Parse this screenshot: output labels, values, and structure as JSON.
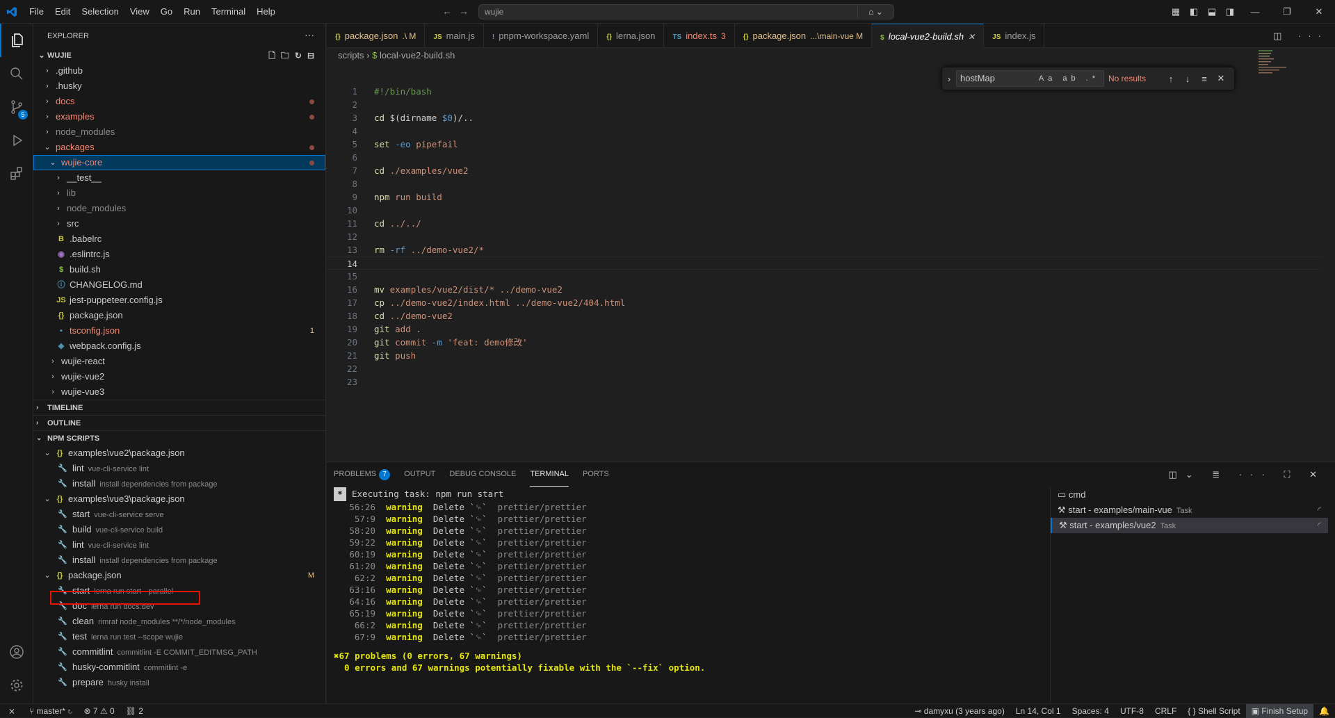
{
  "titlebar": {
    "menu": [
      "File",
      "Edit",
      "Selection",
      "View",
      "Go",
      "Run",
      "Terminal",
      "Help"
    ],
    "search": "wujie"
  },
  "explorer": {
    "title": "EXPLORER",
    "root": "WUJIE",
    "items": [
      {
        "label": ".github",
        "type": "folder",
        "depth": 0,
        "open": false
      },
      {
        "label": ".husky",
        "type": "folder",
        "depth": 0,
        "open": false
      },
      {
        "label": "docs",
        "type": "folder",
        "depth": 0,
        "open": false,
        "modified": true
      },
      {
        "label": "examples",
        "type": "folder",
        "depth": 0,
        "open": false,
        "modified": true
      },
      {
        "label": "node_modules",
        "type": "folder",
        "depth": 0,
        "open": false,
        "dim": true
      },
      {
        "label": "packages",
        "type": "folder",
        "depth": 0,
        "open": true,
        "modified": true
      },
      {
        "label": "wujie-core",
        "type": "folder",
        "depth": 1,
        "open": true,
        "modified": true,
        "selected": true
      },
      {
        "label": "__test__",
        "type": "folder",
        "depth": 2,
        "open": false
      },
      {
        "label": "lib",
        "type": "folder",
        "depth": 2,
        "open": false,
        "dim": true
      },
      {
        "label": "node_modules",
        "type": "folder",
        "depth": 2,
        "open": false,
        "dim": true
      },
      {
        "label": "src",
        "type": "folder",
        "depth": 2,
        "open": false
      },
      {
        "label": ".babelrc",
        "type": "file",
        "depth": 2,
        "icon": "B"
      },
      {
        "label": ".eslintrc.js",
        "type": "file",
        "depth": 2,
        "icon": "◉"
      },
      {
        "label": "build.sh",
        "type": "file",
        "depth": 2,
        "icon": "$"
      },
      {
        "label": "CHANGELOG.md",
        "type": "file",
        "depth": 2,
        "icon": "ⓘ"
      },
      {
        "label": "jest-puppeteer.config.js",
        "type": "file",
        "depth": 2,
        "icon": "JS"
      },
      {
        "label": "package.json",
        "type": "file",
        "depth": 2,
        "icon": "{}"
      },
      {
        "label": "tsconfig.json",
        "type": "file",
        "depth": 2,
        "icon": "ts",
        "count": "1"
      },
      {
        "label": "webpack.config.js",
        "type": "file",
        "depth": 2,
        "icon": "◈"
      },
      {
        "label": "wujie-react",
        "type": "folder",
        "depth": 1,
        "open": false
      },
      {
        "label": "wujie-vue2",
        "type": "folder",
        "depth": 1,
        "open": false
      },
      {
        "label": "wujie-vue3",
        "type": "folder",
        "depth": 1,
        "open": false
      }
    ]
  },
  "sections": {
    "timeline": "TIMELINE",
    "outline": "OUTLINE",
    "npm": "NPM SCRIPTS"
  },
  "npm": [
    {
      "type": "pkg",
      "label": "examples\\vue2\\package.json"
    },
    {
      "type": "script",
      "name": "lint",
      "desc": "vue-cli-service lint"
    },
    {
      "type": "script",
      "name": "install",
      "desc": "install dependencies from package"
    },
    {
      "type": "pkg",
      "label": "examples\\vue3\\package.json"
    },
    {
      "type": "script",
      "name": "start",
      "desc": "vue-cli-service serve"
    },
    {
      "type": "script",
      "name": "build",
      "desc": "vue-cli-service build"
    },
    {
      "type": "script",
      "name": "lint",
      "desc": "vue-cli-service lint"
    },
    {
      "type": "script",
      "name": "install",
      "desc": "install dependencies from package"
    },
    {
      "type": "pkg",
      "label": "package.json",
      "mark": "M"
    },
    {
      "type": "script",
      "name": "start",
      "desc": "lerna run start --parallel"
    },
    {
      "type": "script",
      "name": "doc",
      "desc": "lerna run docs:dev"
    },
    {
      "type": "script",
      "name": "clean",
      "desc": "rimraf node_modules **/*/node_modules"
    },
    {
      "type": "script",
      "name": "test",
      "desc": "lerna run test --scope wujie"
    },
    {
      "type": "script",
      "name": "commitlint",
      "desc": "commitlint -E COMMIT_EDITMSG_PATH"
    },
    {
      "type": "script",
      "name": "husky-commitlint",
      "desc": "commitlint -e"
    },
    {
      "type": "script",
      "name": "prepare",
      "desc": "husky install"
    }
  ],
  "tabs": [
    {
      "icon": "{}",
      "label": "package.json",
      "suffix": ".\\ M",
      "color": "#e2c08d"
    },
    {
      "icon": "JS",
      "label": "main.js",
      "suffix": "",
      "color": "#9d9d9d"
    },
    {
      "icon": "!",
      "label": "pnpm-workspace.yaml",
      "suffix": "",
      "color": "#9d9d9d"
    },
    {
      "icon": "{}",
      "label": "lerna.json",
      "suffix": "",
      "color": "#9d9d9d"
    },
    {
      "icon": "TS",
      "label": "index.ts",
      "suffix": "3",
      "color": "#f48771"
    },
    {
      "icon": "{}",
      "label": "package.json",
      "suffix": "...\\main-vue M",
      "color": "#e2c08d"
    },
    {
      "icon": "$",
      "label": "local-vue2-build.sh",
      "suffix": "✕",
      "color": "#ffffff",
      "active": true
    },
    {
      "icon": "JS",
      "label": "index.js",
      "suffix": "",
      "color": "#9d9d9d"
    }
  ],
  "breadcrumb": [
    "scripts",
    "local-vue2-build.sh"
  ],
  "find": {
    "value": "hostMap",
    "result": "No results"
  },
  "code": [
    [
      [
        "k-com",
        "#!/bin/bash"
      ]
    ],
    [],
    [
      [
        "k-cmd",
        "cd"
      ],
      [
        "k-plain",
        " $(dirname "
      ],
      [
        "k-opt",
        "$0"
      ],
      [
        "k-plain",
        ")/.."
      ]
    ],
    [],
    [
      [
        "k-cmd",
        "set"
      ],
      [
        "k-opt",
        " -eo"
      ],
      [
        "k-str",
        " pipefail"
      ]
    ],
    [],
    [
      [
        "k-cmd",
        "cd"
      ],
      [
        "k-str",
        " ./examples/vue2"
      ]
    ],
    [],
    [
      [
        "k-cmd",
        "npm"
      ],
      [
        "k-str",
        " run build"
      ]
    ],
    [],
    [
      [
        "k-cmd",
        "cd"
      ],
      [
        "k-str",
        " ../../"
      ]
    ],
    [],
    [
      [
        "k-cmd",
        "rm"
      ],
      [
        "k-opt",
        " -rf"
      ],
      [
        "k-str",
        " ../demo-vue2/*"
      ]
    ],
    [],
    [],
    [
      [
        "k-cmd",
        "mv"
      ],
      [
        "k-str",
        " examples/vue2/dist/* ../demo-vue2"
      ]
    ],
    [
      [
        "k-cmd",
        "cp"
      ],
      [
        "k-str",
        " ../demo-vue2/index.html ../demo-vue2/404.html"
      ]
    ],
    [
      [
        "k-cmd",
        "cd"
      ],
      [
        "k-str",
        " ../demo-vue2"
      ]
    ],
    [
      [
        "k-cmd",
        "git"
      ],
      [
        "k-str",
        " add ."
      ]
    ],
    [
      [
        "k-cmd",
        "git"
      ],
      [
        "k-str",
        " commit "
      ],
      [
        "k-opt",
        "-m"
      ],
      [
        "k-str",
        " 'feat: demo修改'"
      ]
    ],
    [
      [
        "k-cmd",
        "git"
      ],
      [
        "k-str",
        " push"
      ]
    ],
    [],
    []
  ],
  "panel": {
    "tabs": [
      "PROBLEMS",
      "OUTPUT",
      "DEBUG CONSOLE",
      "TERMINAL",
      "PORTS"
    ],
    "problems_count": "7",
    "exec": "Executing task: npm run start",
    "lines": [
      "56:26",
      "57:9",
      "58:20",
      "59:22",
      "60:19",
      "61:20",
      "62:2",
      "63:16",
      "64:16",
      "65:19",
      "66:2",
      "67:9"
    ],
    "warn_word": "warning",
    "delete_word": "Delete `␍`",
    "rule": "prettier/prettier",
    "summary1": "✖67 problems (0 errors, 67 warnings)",
    "summary2": "  0 errors and 67 warnings potentially fixable with the `--fix` option.",
    "terminals": [
      {
        "label": "cmd",
        "tag": ""
      },
      {
        "label": "start - examples/main-vue",
        "tag": "Task"
      },
      {
        "label": "start - examples/vue2",
        "tag": "Task",
        "selected": true
      }
    ]
  },
  "status": {
    "branch": "master*",
    "errors": "7",
    "warnings": "0",
    "ports": "2",
    "blame": "damyxu (3 years ago)",
    "position": "Ln 14, Col 1",
    "spaces": "Spaces: 4",
    "encoding": "UTF-8",
    "eol": "CRLF",
    "lang": "Shell Script",
    "finish": "Finish Setup"
  }
}
